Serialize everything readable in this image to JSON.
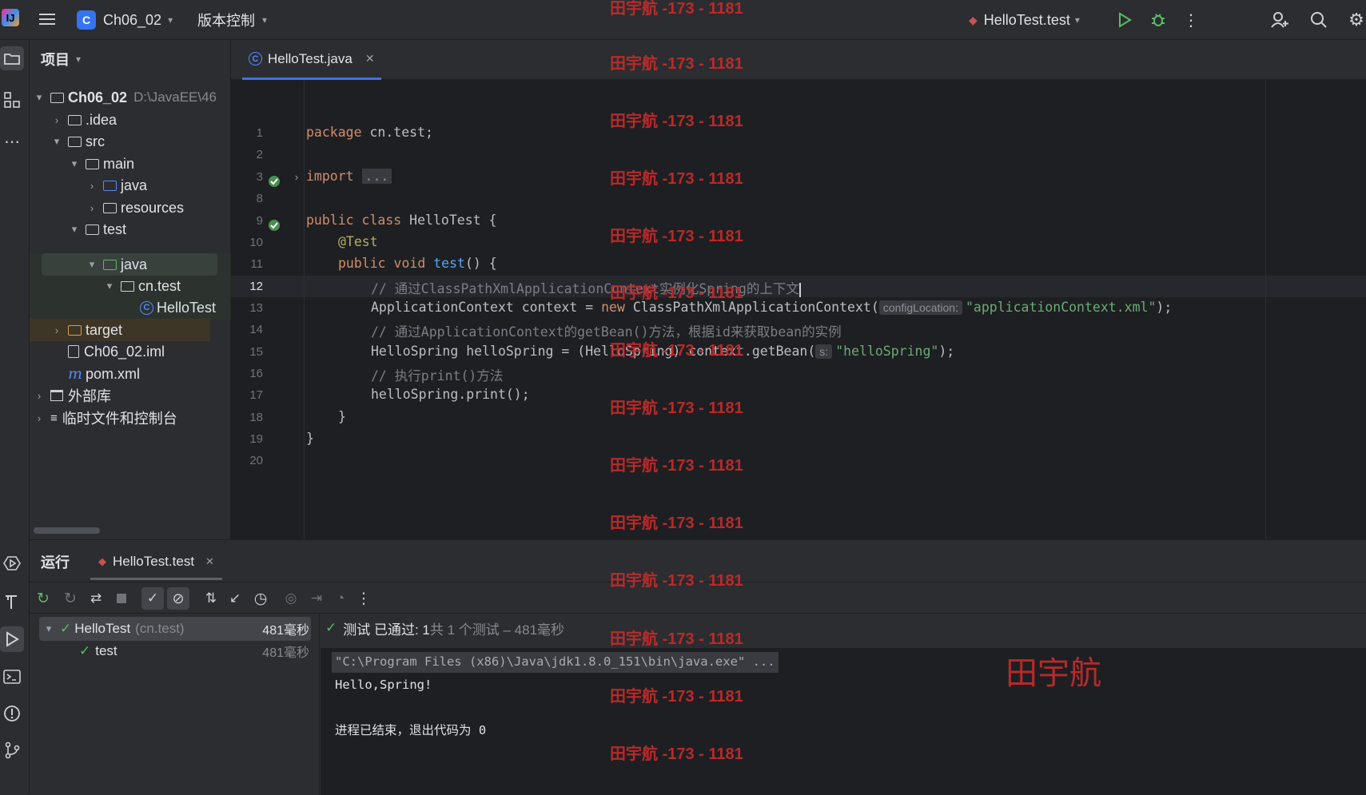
{
  "titlebar": {
    "project_badge": "C",
    "project_name": "Ch06_02",
    "vcs_label": "版本控制",
    "run_config": "HelloTest.test"
  },
  "project_panel": {
    "title": "项目",
    "tree": [
      {
        "label": "Ch06_02",
        "path": "D:\\JavaEE\\46"
      },
      {
        "label": ".idea"
      },
      {
        "label": "src"
      },
      {
        "label": "main"
      },
      {
        "label": "java"
      },
      {
        "label": "resources"
      },
      {
        "label": "test"
      },
      {
        "label": "java"
      },
      {
        "label": "cn.test"
      },
      {
        "label": "HelloTest"
      },
      {
        "label": "target"
      },
      {
        "label": "Ch06_02.iml"
      },
      {
        "label": "pom.xml"
      },
      {
        "label": "外部库"
      },
      {
        "label": "临时文件和控制台"
      }
    ]
  },
  "editor": {
    "tab_label": "HelloTest.java",
    "line_numbers": [
      "1",
      "2",
      "3",
      "8",
      "9",
      "10",
      "11",
      "12",
      "13",
      "14",
      "15",
      "16",
      "17",
      "18",
      "19",
      "20"
    ],
    "current_line": "12",
    "lines": {
      "l1_kw": "package",
      "l1_rest": " cn.test;",
      "l3_kw": "import",
      "l3_fold": "...",
      "l9_kw": "public class",
      "l9_rest": " HelloTest {",
      "l10_ann": "@Test",
      "l11_kw": "public void",
      "l11_fn": "test",
      "l11_rest": "() {",
      "l12_cm": "// 通过ClassPathXmlApplicationContext实例化Spring的上下文",
      "l13_a": "ApplicationContext context = ",
      "l13_kw": "new",
      "l13_b": " ClassPathXmlApplicationContext(",
      "l13_hint": "configLocation:",
      "l13_str": "\"applicationContext.xml\"",
      "l13_c": ");",
      "l14_cm": "// 通过ApplicationContext的getBean()方法，根据id来获取bean的实例",
      "l15_a": "HelloSpring helloSpring = (HelloSpring) context.getBean(",
      "l15_hint": "s:",
      "l15_str": "\"helloSpring\"",
      "l15_c": ");",
      "l16_cm": "// 执行print()方法",
      "l17_a": "helloSpring.print();",
      "l18_a": "}",
      "l19_a": "}"
    }
  },
  "run_panel": {
    "title": "运行",
    "tab_label": "HelloTest.test",
    "tree": {
      "root_label": "HelloTest",
      "root_pkg": "(cn.test)",
      "root_time": "481毫秒",
      "child_label": "test",
      "child_time": "481毫秒"
    },
    "status_passed": "测试 已通过: 1",
    "status_detail": "共 1 个测试 – 481毫秒",
    "console": {
      "cmd": "\"C:\\Program Files (x86)\\Java\\jdk1.8.0_151\\bin\\java.exe\" ...",
      "out1": "Hello,Spring!",
      "out2": "进程已结束，退出代码为 0"
    }
  },
  "watermark": {
    "text": "田宇航 -173 - 1181",
    "big": "田宇航",
    "color": "#c42b2b"
  },
  "colors": {
    "bg": "#2b2d30",
    "editor_bg": "#1e1f22",
    "keyword": "#cf8e6d",
    "string": "#6aab73",
    "comment": "#7a7e85",
    "annotation": "#b3ae60",
    "function": "#56a8f5",
    "accent": "#3574f0",
    "success": "#5fb865"
  }
}
